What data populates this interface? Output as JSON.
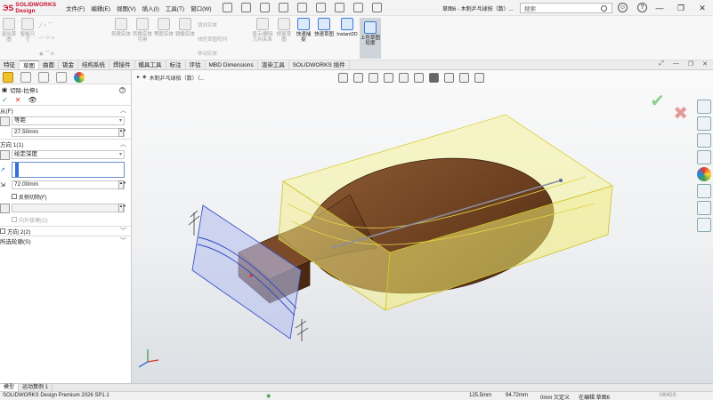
{
  "app": {
    "brand": "SOLIDWORKS Design",
    "doc_title": "草图6 - 木制乒乓球拍（数）...",
    "search_placeholder": "搜索"
  },
  "menu": [
    "文件(F)",
    "编辑(E)",
    "视图(V)",
    "插入(I)",
    "工具(T)",
    "窗口(W)"
  ],
  "ribbon": {
    "buttons": [
      "退出草图",
      "智能尺寸",
      "剪裁实体",
      "转换实体引用",
      "等距实体",
      "镜像实体",
      "线性草图阵列",
      "显示/删除几何关系",
      "修复草图",
      "快速捕捉",
      "Instant2D",
      "上色草图轮廓"
    ],
    "small": [
      "镜向实体",
      "线性草图阵列",
      "移动实体"
    ]
  },
  "tabs": [
    "特征",
    "草图",
    "曲面",
    "钣金",
    "结构系统",
    "焊接件",
    "模具工具",
    "标注",
    "评估",
    "MBD Dimensions",
    "渲染工具",
    "SOLIDWORKS 插件"
  ],
  "active_tab": "草图",
  "property_manager": {
    "title": "切除-拉伸1",
    "from_section": "从(F)",
    "from_value": "等距",
    "offset_value": "27.50mm",
    "dir1_section": "方向 1(1)",
    "end_condition": "给定深度",
    "depth_value": "72.00mm",
    "reverse_cut": "反侧切除(F)",
    "draft_outward": "向外拔模(O)",
    "dir2_section": "方向 2(2)",
    "contours_section": "所选轮廓(S)"
  },
  "graphics": {
    "breadcrumb": "木制乒乓球拍（数）（..."
  },
  "bottom_tabs": [
    "模型",
    "运动算例 1"
  ],
  "status": {
    "product": "SOLIDWORKS Design Premium 2026 SP1.1",
    "x": "125.5mm",
    "y": "94.72mm",
    "z": "0mm 欠定义",
    "editing": "在编辑 草图6",
    "units": "MMGS"
  }
}
